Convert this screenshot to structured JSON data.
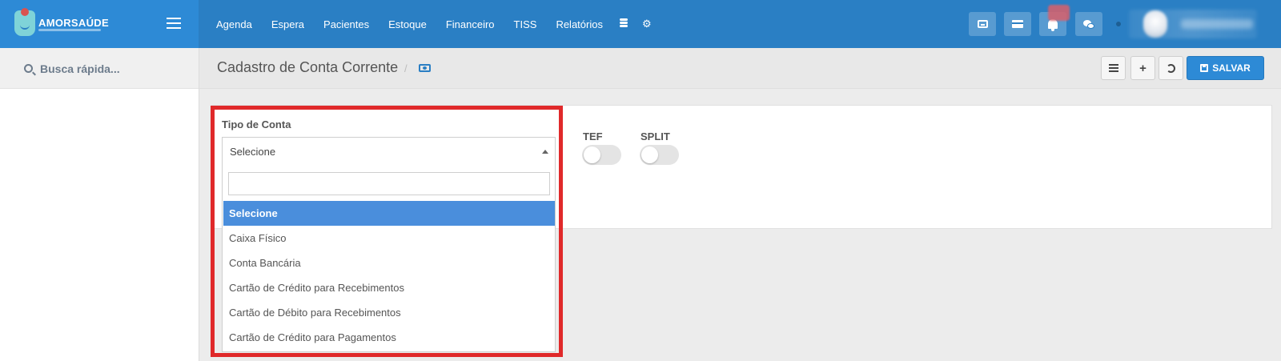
{
  "brand": {
    "name": "AMORSAÚDE"
  },
  "nav": {
    "items": [
      "Agenda",
      "Espera",
      "Pacientes",
      "Estoque",
      "Financeiro",
      "TISS",
      "Relatórios"
    ],
    "icons": [
      "database-icon",
      "gear-icon"
    ]
  },
  "header_icons": [
    "inbox-icon",
    "credit-card-icon",
    "bell-icon",
    "chat-icon"
  ],
  "sidebar": {
    "search_placeholder": "Busca rápida..."
  },
  "page": {
    "title": "Cadastro de Conta Corrente",
    "breadcrumb_separator": "/",
    "save_label": "SALVAR",
    "add_label": "+"
  },
  "form": {
    "tipo_label": "Tipo de Conta",
    "tipo_value": "Selecione",
    "toggles": [
      {
        "label": "TEF",
        "on": false
      },
      {
        "label": "SPLIT",
        "on": false
      }
    ],
    "options": [
      "Selecione",
      "Caixa Físico",
      "Conta Bancária",
      "Cartão de Crédito para Recebimentos",
      "Cartão de Débito para Recebimentos",
      "Cartão de Crédito para Pagamentos"
    ],
    "selected_option": "Selecione"
  },
  "colors": {
    "navbar": "#2a7fc4",
    "brand_bg": "#2d8ad6",
    "highlight_frame": "#e0292a",
    "selected_option_bg": "#4a8edc",
    "save_button": "#2d8ad6"
  }
}
